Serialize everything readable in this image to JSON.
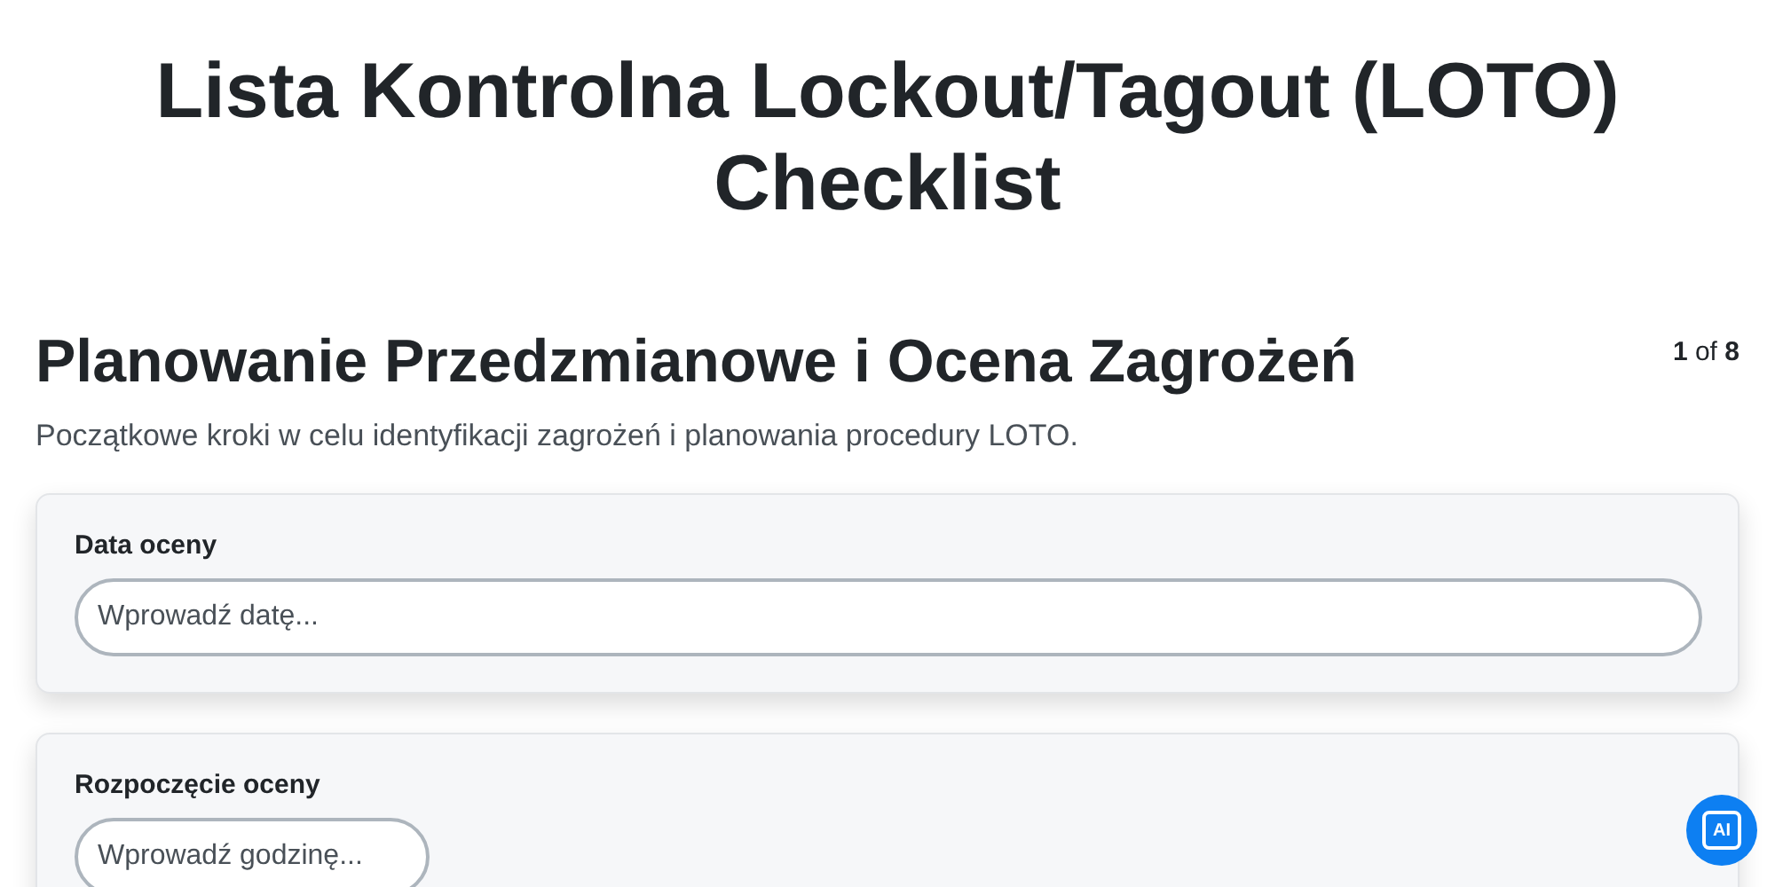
{
  "title": "Lista Kontrolna Lockout/Tagout (LOTO) Checklist",
  "section": {
    "heading": "Planowanie Przedzmianowe i Ocena Zagrożeń",
    "counter": "**1** of **8**",
    "description": "Początkowe kroki w celu identyfikacji zagrożeń i planowania procedury LOTO."
  },
  "fields": [
    {
      "kind": "date",
      "label": "Data oceny",
      "placeholder": "Wprowadź datę..."
    },
    {
      "kind": "time",
      "label": "Rozpoczęcie oceny",
      "placeholder": "Wprowadź godzinę..."
    }
  ],
  "ai_button": {
    "label": "AI"
  }
}
